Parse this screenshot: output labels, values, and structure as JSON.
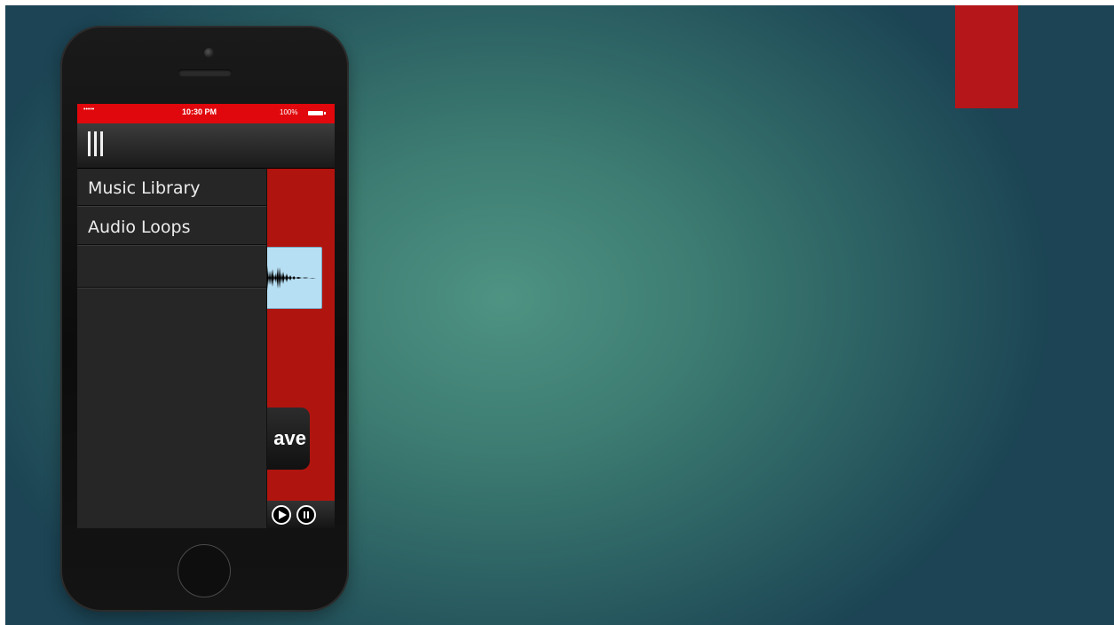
{
  "colors": {
    "accent_red": "#b5161a",
    "status_bar_red": "#e0080c",
    "content_red": "#b0140f",
    "drawer_bg": "#262626",
    "background_center": "#4e9383",
    "background_edge": "#1c4454"
  },
  "status_bar": {
    "signal": "•••••",
    "time": "10:30 PM",
    "battery": "100%",
    "battery_icon": "battery-full-icon"
  },
  "nav_bar": {
    "menu_icon": "hamburger-menu-icon"
  },
  "drawer": {
    "items": [
      {
        "label": "Music Library"
      },
      {
        "label": "Audio Loops"
      },
      {
        "label": ""
      }
    ]
  },
  "content": {
    "waveform_icon": "audio-waveform-icon",
    "save_label_visible": "ave"
  },
  "playback": {
    "play_icon": "play-icon",
    "pause_icon": "pause-icon"
  }
}
